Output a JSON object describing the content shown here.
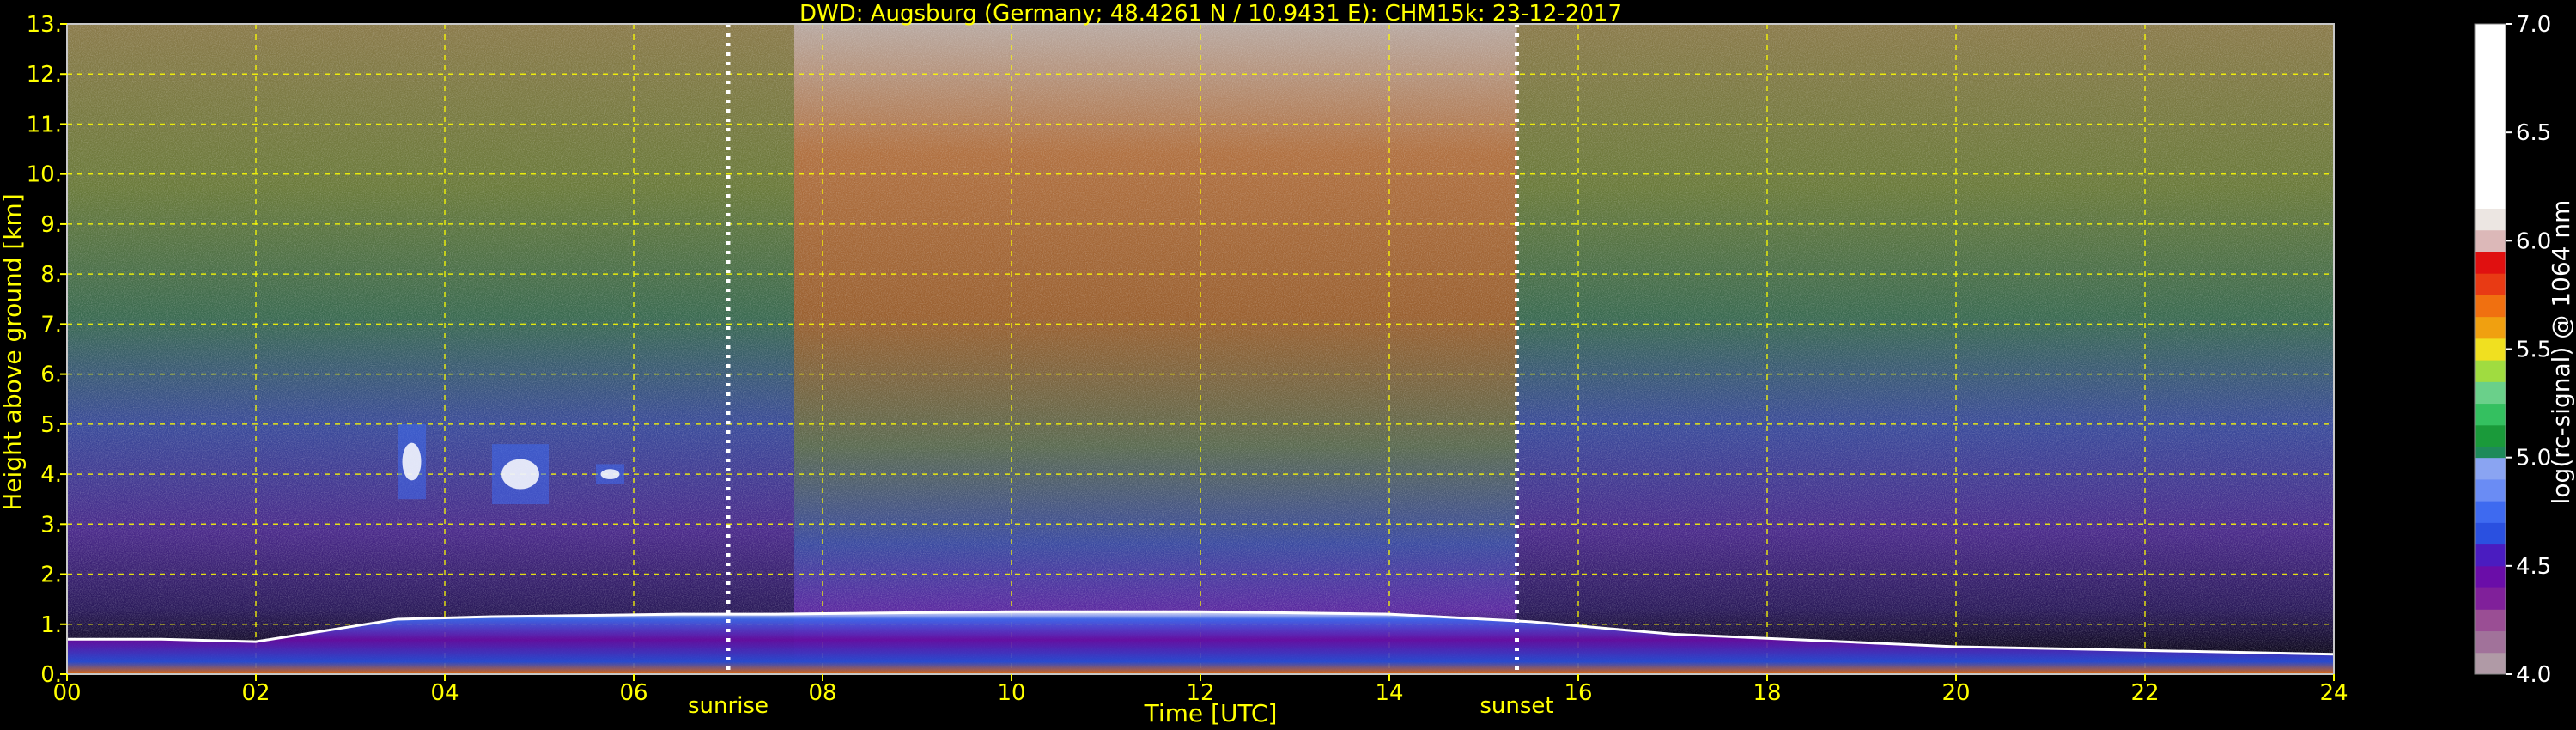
{
  "chart_data": {
    "type": "heatmap",
    "title": "DWD: Augsburg (Germany; 48.4261 N / 10.9431 E):    CHM15k: 23-12-2017",
    "xlabel": "Time [UTC]",
    "ylabel": "Height above ground [km]",
    "xlim": [
      0,
      24
    ],
    "ylim": [
      0,
      13
    ],
    "x_ticks": [
      0,
      2,
      4,
      6,
      8,
      10,
      12,
      14,
      16,
      18,
      20,
      22,
      24
    ],
    "x_tick_labels": [
      "00",
      "02",
      "04",
      "06",
      "08",
      "10",
      "12",
      "14",
      "16",
      "18",
      "20",
      "22",
      "24"
    ],
    "y_ticks": [
      0,
      1,
      2,
      3,
      4,
      5,
      6,
      7,
      8,
      9,
      10,
      11,
      12,
      13
    ],
    "y_tick_labels": [
      "0.",
      "1.",
      "2.",
      "3.",
      "4.",
      "5.",
      "6.",
      "7.",
      "8.",
      "9.",
      "10.",
      "11.",
      "12.",
      "13."
    ],
    "grid": true,
    "grid_color": "#ffff00",
    "events": [
      {
        "label": "sunrise",
        "time": 7.0
      },
      {
        "label": "sunset",
        "time": 15.35
      }
    ],
    "boundary_layer_top": [
      {
        "t": 0.0,
        "h": 0.7
      },
      {
        "t": 1.0,
        "h": 0.7
      },
      {
        "t": 2.0,
        "h": 0.65
      },
      {
        "t": 3.5,
        "h": 1.1
      },
      {
        "t": 4.5,
        "h": 1.15
      },
      {
        "t": 6.5,
        "h": 1.2
      },
      {
        "t": 7.5,
        "h": 1.2
      },
      {
        "t": 10.0,
        "h": 1.25
      },
      {
        "t": 12.0,
        "h": 1.25
      },
      {
        "t": 14.0,
        "h": 1.2
      },
      {
        "t": 15.5,
        "h": 1.05
      },
      {
        "t": 17.0,
        "h": 0.8
      },
      {
        "t": 20.0,
        "h": 0.55
      },
      {
        "t": 24.0,
        "h": 0.4
      }
    ],
    "elevated_layers": [
      {
        "t_start": 3.5,
        "t_end": 3.8,
        "h_bottom": 3.5,
        "h_top": 5.0
      },
      {
        "t_start": 4.5,
        "t_end": 5.1,
        "h_bottom": 3.4,
        "h_top": 4.6
      },
      {
        "t_start": 5.6,
        "t_end": 5.9,
        "h_bottom": 3.8,
        "h_top": 4.2
      }
    ],
    "colorbar": {
      "label": "log(rc-signal) @ 1064 nm",
      "min": 4.0,
      "max": 7.0,
      "ticks": [
        4.0,
        4.5,
        5.0,
        5.5,
        6.0,
        6.5,
        7.0
      ],
      "tick_labels": [
        "4.0",
        "4.5",
        "5.0",
        "5.5",
        "6.0",
        "6.5",
        "7.0"
      ],
      "colors": [
        {
          "v0": 4.0,
          "v1": 4.1,
          "color": "#b09aa6"
        },
        {
          "v0": 4.1,
          "v1": 4.2,
          "color": "#a1729a"
        },
        {
          "v0": 4.2,
          "v1": 4.3,
          "color": "#9a4e94"
        },
        {
          "v0": 4.3,
          "v1": 4.4,
          "color": "#80209a"
        },
        {
          "v0": 4.4,
          "v1": 4.5,
          "color": "#6a0da8"
        },
        {
          "v0": 4.5,
          "v1": 4.6,
          "color": "#4a1cc0"
        },
        {
          "v0": 4.6,
          "v1": 4.7,
          "color": "#2a50e0"
        },
        {
          "v0": 4.7,
          "v1": 4.8,
          "color": "#3e6af0"
        },
        {
          "v0": 4.8,
          "v1": 4.9,
          "color": "#6a8cf4"
        },
        {
          "v0": 4.9,
          "v1": 5.0,
          "color": "#8aa4f2"
        },
        {
          "v0": 5.0,
          "v1": 5.05,
          "color": "#1e8a5a"
        },
        {
          "v0": 5.05,
          "v1": 5.15,
          "color": "#1a9a3a"
        },
        {
          "v0": 5.15,
          "v1": 5.25,
          "color": "#34c060"
        },
        {
          "v0": 5.25,
          "v1": 5.35,
          "color": "#6ad08a"
        },
        {
          "v0": 5.35,
          "v1": 5.45,
          "color": "#a0dc40"
        },
        {
          "v0": 5.45,
          "v1": 5.55,
          "color": "#f0e020"
        },
        {
          "v0": 5.55,
          "v1": 5.65,
          "color": "#f0a010"
        },
        {
          "v0": 5.65,
          "v1": 5.75,
          "color": "#f07010"
        },
        {
          "v0": 5.75,
          "v1": 5.85,
          "color": "#e83a14"
        },
        {
          "v0": 5.85,
          "v1": 5.95,
          "color": "#e01010"
        },
        {
          "v0": 5.95,
          "v1": 6.05,
          "color": "#dcb8b8"
        },
        {
          "v0": 6.05,
          "v1": 6.15,
          "color": "#ece6e2"
        },
        {
          "v0": 6.15,
          "v1": 7.0,
          "color": "#ffffff"
        }
      ]
    }
  }
}
